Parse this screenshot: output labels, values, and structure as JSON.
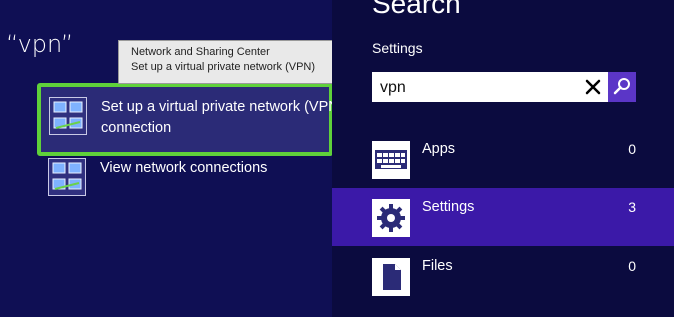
{
  "query": "“vpn”",
  "tooltip": {
    "line1": "Network and Sharing Center",
    "line2": "Set up a virtual private network (VPN)"
  },
  "results": [
    {
      "label_line1": "Set up a virtual private network (VPN",
      "label_line2": "connection",
      "icon": "network-wizard-icon"
    },
    {
      "label": "View network connections",
      "icon": "network-connections-icon"
    }
  ],
  "search_pane": {
    "title": "Search",
    "scope": "Settings",
    "search": {
      "value": "vpn"
    },
    "categories": [
      {
        "label": "Apps",
        "count": "0",
        "icon": "keyboard-icon"
      },
      {
        "label": "Settings",
        "count": "3",
        "icon": "gear-icon"
      },
      {
        "label": "Files",
        "count": "0",
        "icon": "document-icon"
      }
    ]
  },
  "colors": {
    "background": "#0f0f54",
    "pane_background": "#0b0b3f",
    "selection_highlight": "#5fd13a",
    "active_category": "#3b19a8",
    "search_button": "#5b36c7"
  }
}
